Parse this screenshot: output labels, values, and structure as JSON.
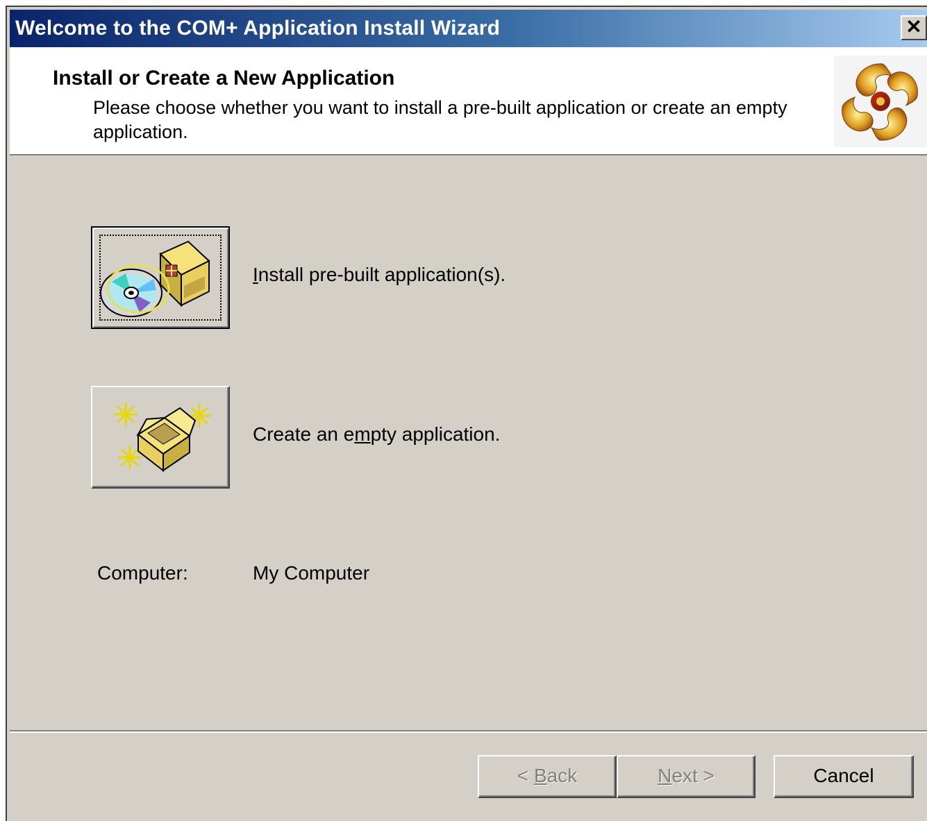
{
  "window": {
    "title": "Welcome to the COM+ Application Install Wizard",
    "close_label": "✕"
  },
  "header": {
    "title": "Install or Create a New Application",
    "description": "Please choose whether you want to install a pre-built application or create an empty application."
  },
  "options": [
    {
      "label_pre": "",
      "label_mnemonic": "I",
      "label_post": "nstall pre-built application(s).",
      "icon": "cd-package-icon"
    },
    {
      "label_pre": "Create an e",
      "label_mnemonic": "m",
      "label_post": "pty application.",
      "icon": "empty-package-icon"
    }
  ],
  "computer": {
    "label": "Computer:",
    "value": "My Computer"
  },
  "buttons": {
    "back": {
      "pre": "< ",
      "mnemonic": "B",
      "post": "ack"
    },
    "next": {
      "pre": "",
      "mnemonic": "N",
      "post": "ext >"
    },
    "cancel": "Cancel"
  },
  "colors": {
    "titlebar_start": "#0a246a",
    "titlebar_end": "#a6caf0",
    "dialog_face": "#d4d0c8"
  }
}
